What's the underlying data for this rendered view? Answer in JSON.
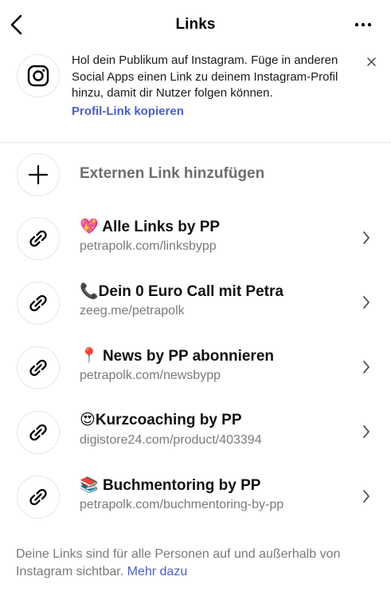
{
  "header": {
    "title": "Links",
    "back_icon": "chevron-left-icon",
    "more_icon": "more-horizontal-icon"
  },
  "banner": {
    "icon": "instagram-icon",
    "text": "Hol dein Publikum auf Instagram. Füge in anderen Social Apps einen Link zu deinem Instagram-Profil hinzu, damit dir Nutzer folgen können.",
    "link_label": "Profil-Link kopieren",
    "close_icon": "close-icon"
  },
  "add_link": {
    "icon": "plus-icon",
    "label": "Externen Link hinzufügen"
  },
  "links": [
    {
      "emoji": "💖",
      "title": "Alle Links by PP",
      "url": "petrapolk.com/linksbypp"
    },
    {
      "emoji": "📞",
      "title": "Dein 0 Euro Call mit Petra",
      "url": "zeeg.me/petrapolk"
    },
    {
      "emoji": "📍",
      "title": "News by PP abonnieren",
      "url": "petrapolk.com/newsbypp"
    },
    {
      "emoji": "😍",
      "title": "Kurzcoaching by PP",
      "url": "digistore24.com/product/403394"
    },
    {
      "emoji": "📚",
      "title": "Buchmentoring by PP",
      "url": "petrapolk.com/buchmentoring-by-pp"
    }
  ],
  "footer": {
    "text": "Deine Links sind für alle Personen auf und außerhalb von Instagram sichtbar.",
    "link_label": "Mehr dazu"
  },
  "colors": {
    "accent": "#4a5fc9",
    "secondary_text": "#7a7a7a",
    "border": "#e6e6e6"
  }
}
